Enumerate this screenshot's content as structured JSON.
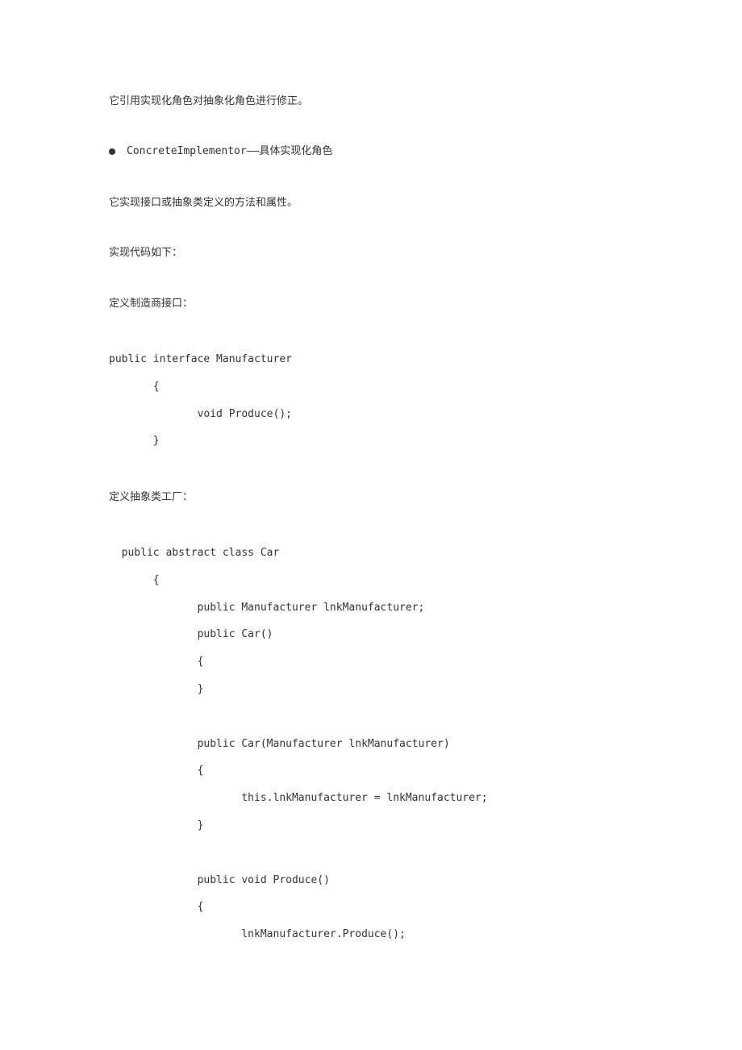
{
  "paragraphs": {
    "p1": "它引用实现化角色对抽象化角色进行修正。",
    "bullet_text": "ConcreteImplementor——具体实现化角色",
    "p2": "它实现接口或抽象类定义的方法和属性。",
    "p3": "实现代码如下：",
    "p4": "定义制造商接口：",
    "p5": "定义抽象类工厂："
  },
  "code": {
    "block1": "public interface Manufacturer\n       {\n              void Produce();\n       }",
    "block2": "  public abstract class Car\n       {\n              public Manufacturer lnkManufacturer;\n              public Car()\n              {\n              }\n\n              public Car(Manufacturer lnkManufacturer)\n              {\n                     this.lnkManufacturer = lnkManufacturer;\n              }\n\n              public void Produce()\n              {\n                     lnkManufacturer.Produce();"
  }
}
